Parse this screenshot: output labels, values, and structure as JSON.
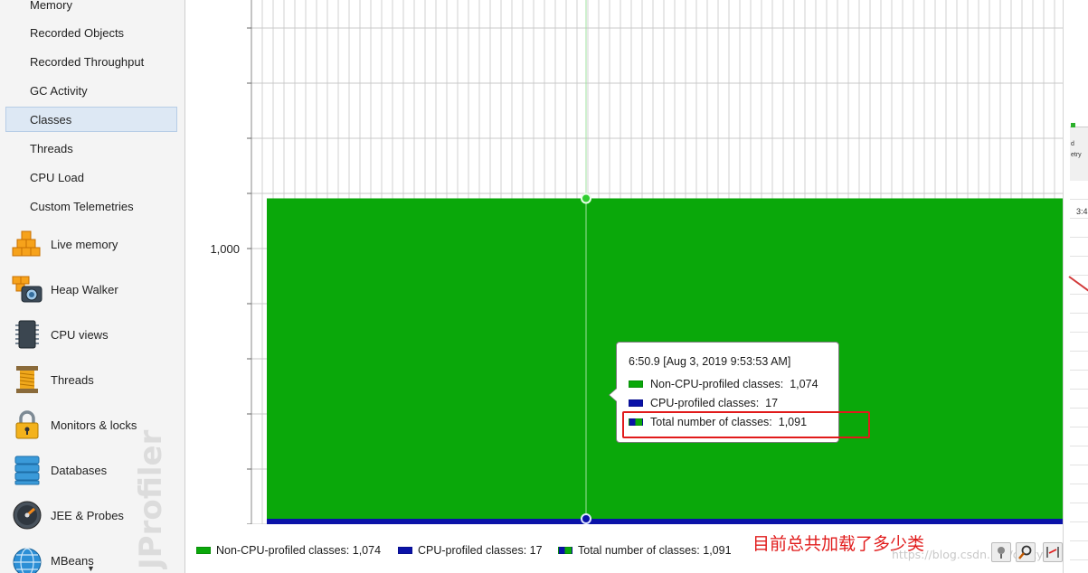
{
  "sidebar": {
    "sub_items": [
      {
        "label": "Memory",
        "selected": false
      },
      {
        "label": "Recorded Objects",
        "selected": false
      },
      {
        "label": "Recorded Throughput",
        "selected": false
      },
      {
        "label": "GC Activity",
        "selected": false
      },
      {
        "label": "Classes",
        "selected": true
      },
      {
        "label": "Threads",
        "selected": false
      },
      {
        "label": "CPU Load",
        "selected": false
      },
      {
        "label": "Custom Telemetries",
        "selected": false
      }
    ],
    "main_items": [
      {
        "label": "Live memory",
        "icon": "live-memory-icon"
      },
      {
        "label": "Heap Walker",
        "icon": "heap-walker-camera-icon"
      },
      {
        "label": "CPU views",
        "icon": "cpu-chip-icon"
      },
      {
        "label": "Threads",
        "icon": "threads-spool-icon"
      },
      {
        "label": "Monitors & locks",
        "icon": "padlock-icon"
      },
      {
        "label": "Databases",
        "icon": "database-icon"
      },
      {
        "label": "JEE & Probes",
        "icon": "gauge-icon"
      },
      {
        "label": "MBeans",
        "icon": "globe-icon"
      }
    ],
    "watermark": "JProfiler"
  },
  "chart_data": {
    "type": "area",
    "y_ticks": [
      "1,000"
    ],
    "series": [
      {
        "name": "Non-CPU-profiled classes",
        "color": "#0aa80a",
        "value": 1074
      },
      {
        "name": "CPU-profiled classes",
        "color": "#0a12a8",
        "value": 17
      }
    ],
    "total": {
      "name": "Total number of classes",
      "value": 1091
    },
    "grid": true
  },
  "tooltip": {
    "time": "6:50.9 [Aug 3, 2019 9:53:53 AM]",
    "rows": [
      {
        "label": "Non-CPU-profiled classes:",
        "value": "1,074",
        "swatch": "green"
      },
      {
        "label": "CPU-profiled classes:",
        "value": "17",
        "swatch": "blue"
      },
      {
        "label": "Total number of classes:",
        "value": "1,091",
        "swatch": "mix"
      }
    ]
  },
  "annotation": {
    "text": "目前总共加载了多少类",
    "color": "#e11b1b"
  },
  "legend": [
    {
      "text": "Non-CPU-profiled classes: 1,074",
      "swatch": "green"
    },
    {
      "text": "CPU-profiled classes: 17",
      "swatch": "blue"
    },
    {
      "text": "Total number of classes: 1,091",
      "swatch": "mix"
    }
  ],
  "watermark_url": "https://blog.csdn.net/crazy_zy...",
  "right_strip": {
    "text1": "d",
    "text2": "etry",
    "time": "3:4"
  }
}
